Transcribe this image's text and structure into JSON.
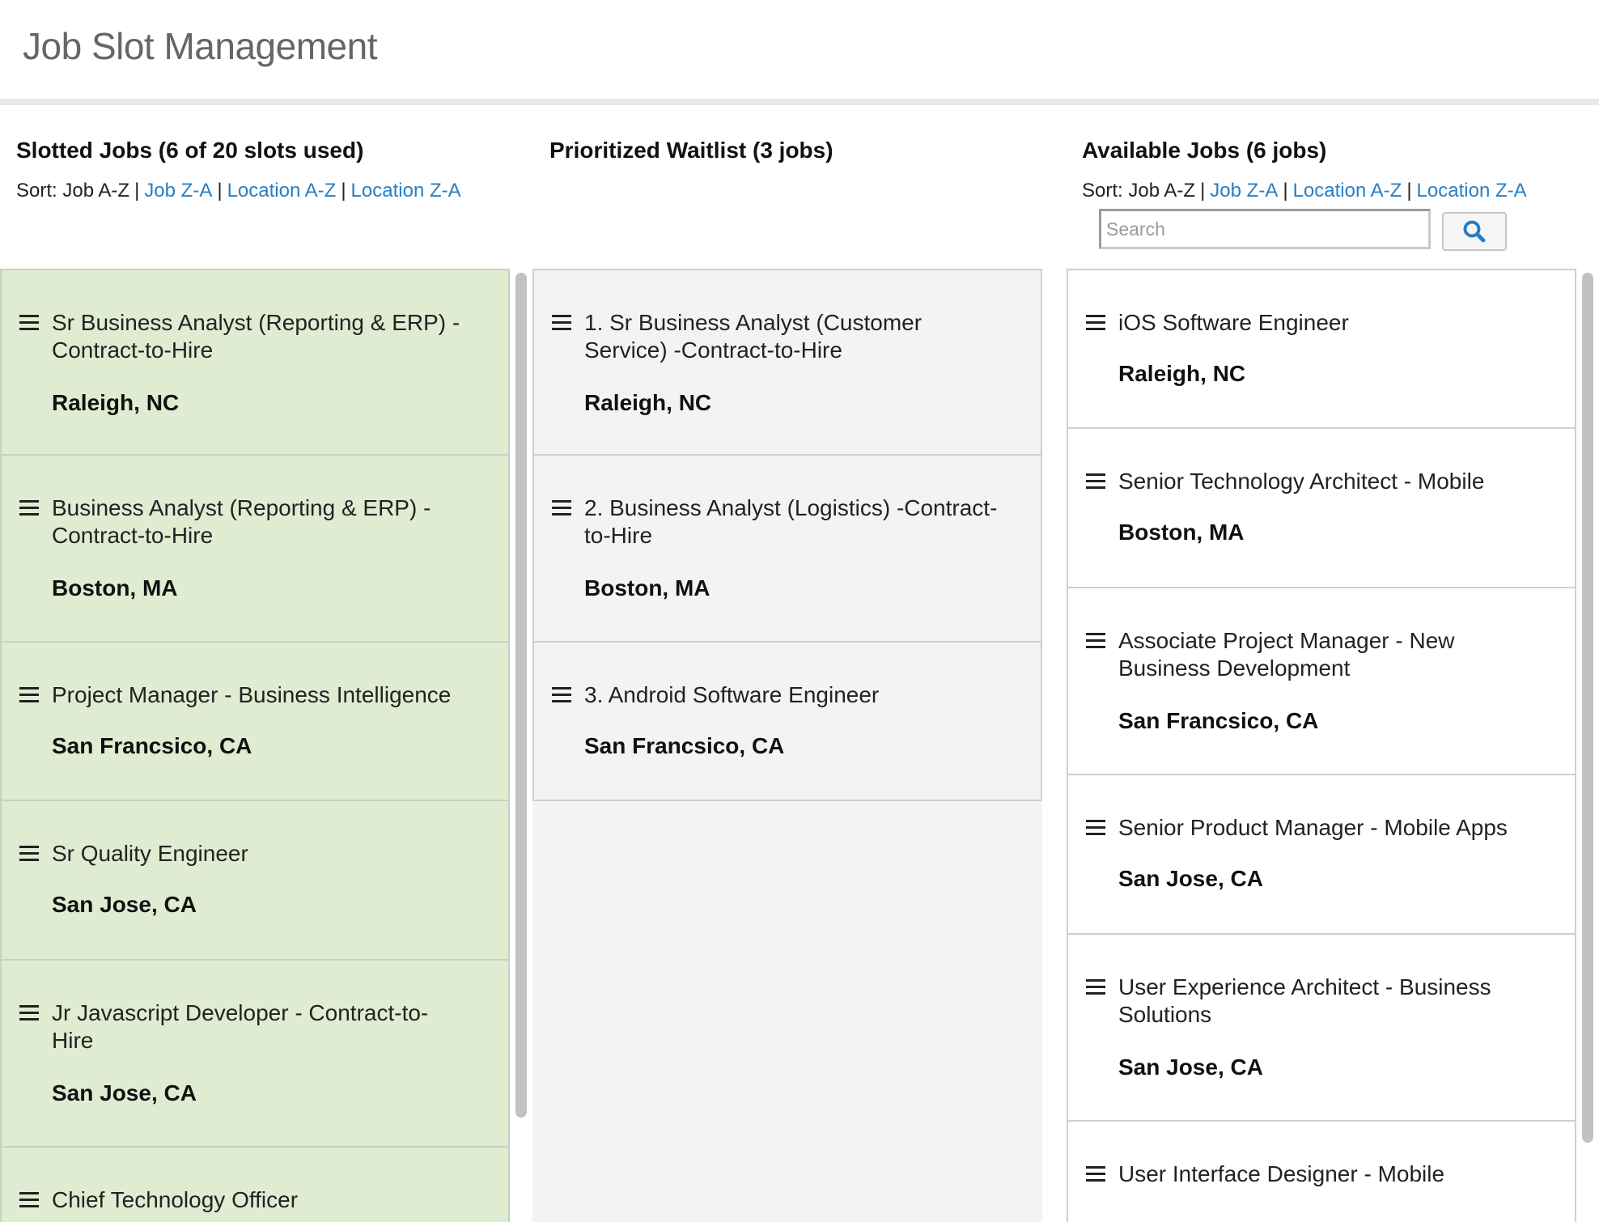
{
  "page": {
    "title": "Job Slot Management"
  },
  "columns": {
    "slotted": {
      "title": "Slotted Jobs (6 of 20 slots used)",
      "sort": {
        "label": "Sort:",
        "current": "Job A-Z",
        "options": [
          "Job Z-A",
          "Location A-Z",
          "Location Z-A"
        ]
      },
      "jobs": [
        {
          "title": "Sr Business Analyst (Reporting & ERP) - Contract-to-Hire",
          "location": "Raleigh, NC"
        },
        {
          "title": "Business Analyst (Reporting & ERP) - Contract-to-Hire",
          "location": "Boston, MA"
        },
        {
          "title": "Project Manager - Business Intelligence",
          "location": "San Francsico, CA"
        },
        {
          "title": "Sr Quality Engineer",
          "location": "San Jose, CA"
        },
        {
          "title": "Jr Javascript Developer - Contract-to-Hire",
          "location": "San Jose, CA"
        },
        {
          "title": "Chief Technology Officer",
          "location": ""
        }
      ]
    },
    "waitlist": {
      "title": "Prioritized Waitlist (3 jobs)",
      "jobs": [
        {
          "title": "1. Sr Business Analyst (Customer Service) -Contract-to-Hire",
          "location": "Raleigh, NC"
        },
        {
          "title": "2. Business Analyst (Logistics) -Contract-to-Hire",
          "location": "Boston, MA"
        },
        {
          "title": "3. Android Software Engineer",
          "location": "San Francsico, CA"
        }
      ]
    },
    "available": {
      "title": "Available Jobs (6 jobs)",
      "sort": {
        "label": "Sort:",
        "current": "Job A-Z",
        "options": [
          "Job Z-A",
          "Location A-Z",
          "Location Z-A"
        ]
      },
      "search": {
        "placeholder": "Search",
        "value": ""
      },
      "jobs": [
        {
          "title": "iOS Software Engineer",
          "location": "Raleigh, NC"
        },
        {
          "title": "Senior Technology Architect - Mobile",
          "location": "Boston, MA"
        },
        {
          "title": "Associate Project Manager - New Business Development",
          "location": "San Francsico, CA"
        },
        {
          "title": "Senior Product Manager - Mobile Apps",
          "location": "San Jose, CA"
        },
        {
          "title": "User Experience Architect - Business Solutions",
          "location": "San Jose, CA"
        },
        {
          "title": "User Interface Designer - Mobile",
          "location": ""
        }
      ]
    }
  },
  "colors": {
    "slotted_bg": "#dfecd2",
    "waitlist_bg": "#f3f3f3",
    "link": "#2a7ec2",
    "search_icon": "#2a7ec2"
  },
  "icons": {
    "drag": "drag-handle-icon",
    "search": "search-icon"
  }
}
